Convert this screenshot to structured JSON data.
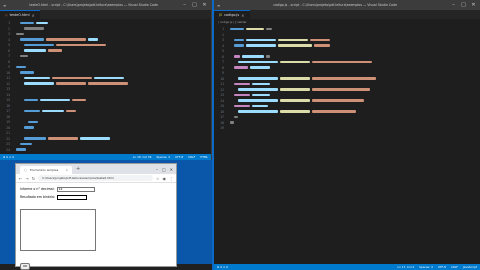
{
  "left_editor": {
    "title": "testeO.html - script - C:\\Users\\projeto\\pdf-leitura\\exemplos — Visual Studio Code",
    "tab": "testeO.html",
    "statusbar": {
      "left": "⊗ 0 ⚠ 0",
      "ln_col": "Ln 18, Col 39",
      "spaces": "Spaces: 4",
      "encoding": "UTF-8",
      "eol": "CRLF",
      "lang": "HTML"
    }
  },
  "right_editor": {
    "title": "codigo.js - script - C:\\Users\\projeto\\pdf-leitura\\exemplos — Visual Studio Code",
    "tab": "codigo.js",
    "statusbar": {
      "left": "⊗ 0 ⚠ 0",
      "ln_col": "Ln 17, Col 2",
      "spaces": "Spaces: 4",
      "encoding": "UTF-8",
      "eol": "CRLF",
      "lang": "JavaScript"
    }
  },
  "browser": {
    "tab_title": "Formulário simples",
    "url": "C:/Users/projeto/pdf-leitura/exemplos/teste0.html",
    "label_n1": "Informe o n° decimal:",
    "value_n1": "12",
    "label_n2": "Resultado em binário:",
    "button_label": "OK"
  },
  "colors": {
    "accent": "#007acc",
    "editor_bg": "#1e1e1e",
    "desktop": "#0a56a8"
  }
}
